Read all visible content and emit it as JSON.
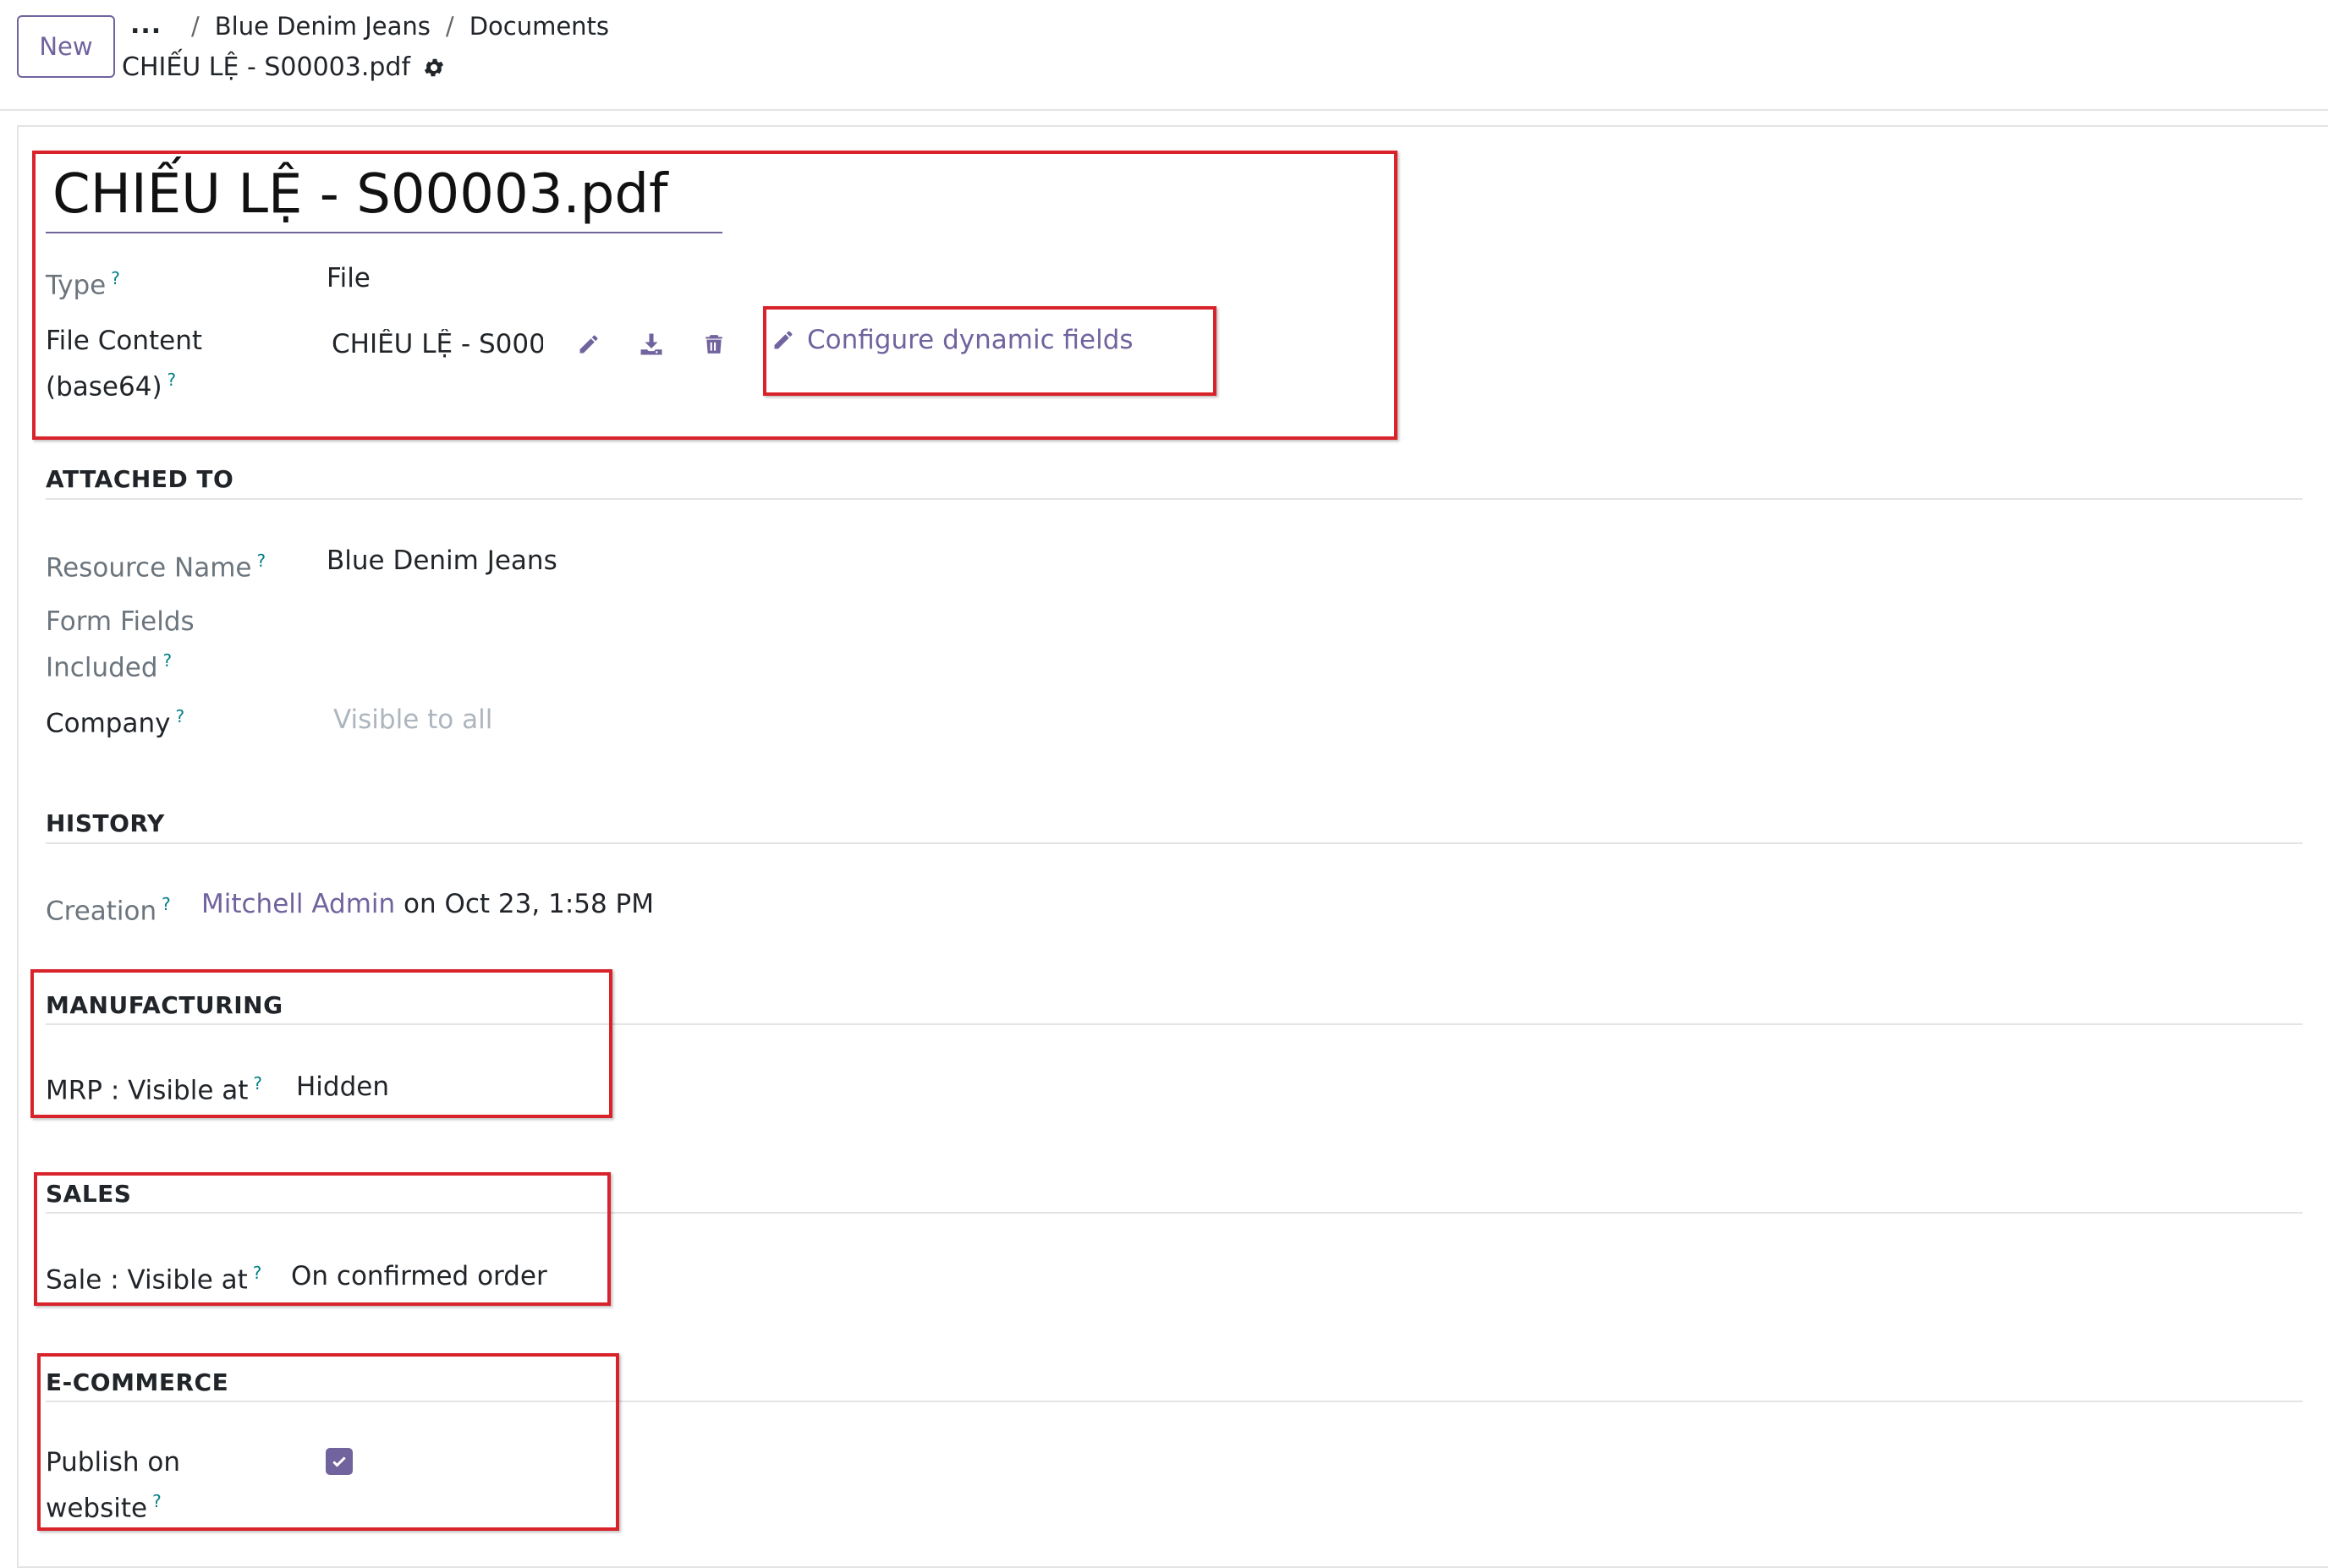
{
  "control_panel": {
    "new_button": "New",
    "breadcrumb": {
      "ellipsis": "...",
      "separator": "/",
      "items": [
        "Blue Denim Jeans",
        "Documents"
      ]
    },
    "record_name": "CHIẾU LỆ - S00003.pdf"
  },
  "form": {
    "name": "CHIẾU LỆ - S00003.pdf",
    "help_mark": "?",
    "type": {
      "label": "Type",
      "value": "File"
    },
    "file_content": {
      "label_line1": "File Content",
      "label_line2": "(base64)",
      "file_name": "CHIẾU LỆ - S00003.pdf",
      "configure_label": "Configure dynamic fields"
    },
    "attached_to": {
      "title": "ATTACHED TO",
      "resource_name": {
        "label": "Resource Name",
        "value": "Blue Denim Jeans"
      },
      "form_fields": {
        "label_line1": "Form Fields",
        "label_line2": "Included"
      },
      "company": {
        "label": "Company",
        "placeholder": "Visible to all"
      }
    },
    "history": {
      "title": "HISTORY",
      "creation": {
        "label": "Creation",
        "user": "Mitchell Admin",
        "date": "on Oct 23, 1:58 PM"
      }
    },
    "manufacturing": {
      "title": "MANUFACTURING",
      "mrp_visible": {
        "label": "MRP : Visible at",
        "value": "Hidden"
      }
    },
    "sales": {
      "title": "SALES",
      "sale_visible": {
        "label": "Sale : Visible at",
        "value": "On confirmed order"
      }
    },
    "ecommerce": {
      "title": "E-COMMERCE",
      "publish": {
        "label_line1": "Publish on",
        "label_line2": "website",
        "checked": true
      }
    }
  },
  "colors": {
    "accent": "#71639e",
    "help": "#017e84",
    "highlight_box": "#d9232b",
    "muted_label": "#6c757d",
    "placeholder": "#adb5bd"
  }
}
